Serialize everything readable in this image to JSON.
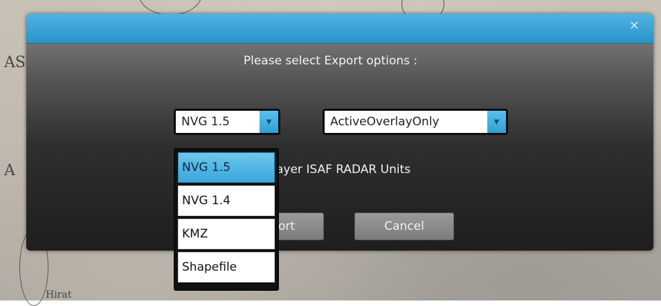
{
  "map": {
    "labels": [
      "AS",
      "A",
      "Hirat"
    ]
  },
  "dialog": {
    "close_icon": "×",
    "prompt": "Please select Export options :",
    "format_select": {
      "value": "NVG 1.5",
      "options": [
        "NVG 1.5",
        "NVG 1.4",
        "KMZ",
        "Shapefile"
      ],
      "highlighted": "NVG 1.5"
    },
    "scope_select": {
      "value": "ActiveOverlayOnly"
    },
    "layer_label": "ayer ISAF RADAR Units",
    "export_button": "ort",
    "cancel_button": "Cancel"
  },
  "colors": {
    "titlebar": "#2a93c9",
    "dropdown_arrow": "#2f9fd6",
    "highlight": "#3aa6dc"
  }
}
